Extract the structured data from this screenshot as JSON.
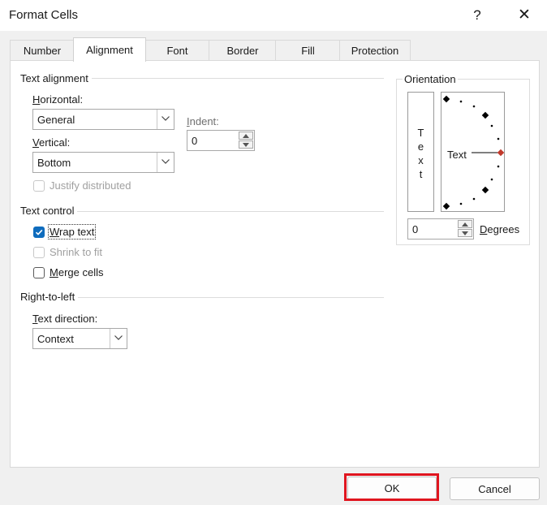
{
  "window": {
    "title": "Format Cells",
    "help_glyph": "?",
    "close_glyph": "✕"
  },
  "tabs": [
    "Number",
    "Alignment",
    "Font",
    "Border",
    "Fill",
    "Protection"
  ],
  "active_tab": "Alignment",
  "text_alignment": {
    "group_title": "Text alignment",
    "horizontal_label_ul": "H",
    "horizontal_label_rest": "orizontal:",
    "horizontal_value": "General",
    "vertical_label_ul": "V",
    "vertical_label_rest": "ertical:",
    "vertical_value": "Bottom",
    "indent_label_ul": "I",
    "indent_label_rest": "ndent:",
    "indent_value": "0",
    "justify_distributed": "Justify distributed"
  },
  "text_control": {
    "group_title": "Text control",
    "wrap_text_ul": "W",
    "wrap_text_rest": "rap text",
    "wrap_text_checked": true,
    "shrink_to_fit": "Shrink to fit",
    "merge_cells_ul": "M",
    "merge_cells_rest": "erge cells"
  },
  "right_to_left": {
    "group_title": "Right-to-left",
    "text_direction_label_ul": "T",
    "text_direction_label_rest": "ext direction:",
    "text_direction_value": "Context"
  },
  "orientation": {
    "group_title": "Orientation",
    "vertical_letters": [
      "T",
      "e",
      "x",
      "t"
    ],
    "dial_text": "Text",
    "degrees_value": "0",
    "degrees_label_ul": "D",
    "degrees_label_rest": "egrees"
  },
  "buttons": {
    "ok": "OK",
    "cancel": "Cancel"
  },
  "colors": {
    "accent": "#0f6cbd",
    "highlight": "#e0151f",
    "dial_marker": "#c0392b"
  }
}
